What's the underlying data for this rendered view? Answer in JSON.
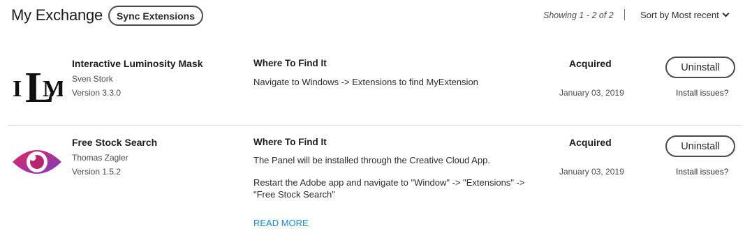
{
  "header": {
    "title": "My Exchange",
    "sync_label": "Sync Extensions",
    "showing": "Showing 1 - 2 of 2",
    "sort_label": "Sort by Most recent"
  },
  "extensions": [
    {
      "name": "Interactive Luminosity Mask",
      "author": "Sven Stork",
      "version": "Version 3.3.0",
      "logo_letters": [
        "I",
        "L",
        "M"
      ],
      "where_title": "Where To Find It",
      "where_text": [
        "Navigate to Windows -> Extensions to find MyExtension"
      ],
      "status": "Acquired",
      "date": "January 03, 2019",
      "uninstall_label": "Uninstall",
      "issues_label": "Install issues?"
    },
    {
      "name": "Free Stock Search",
      "author": "Thomas Zagler",
      "version": "Version 1.5.2",
      "where_title": "Where To Find It",
      "where_text": [
        "The Panel will be installed through the Creative Cloud App.",
        "Restart the Adobe app and navigate to \"Window\" -> \"Extensions\" -> \"Free Stock Search\""
      ],
      "read_more": "READ MORE",
      "status": "Acquired",
      "date": "January 03, 2019",
      "uninstall_label": "Uninstall",
      "issues_label": "Install issues?"
    }
  ],
  "colors": {
    "link": "#1b86c9",
    "eye_gradient_start": "#e0245e",
    "eye_gradient_end": "#7b3fc6"
  }
}
